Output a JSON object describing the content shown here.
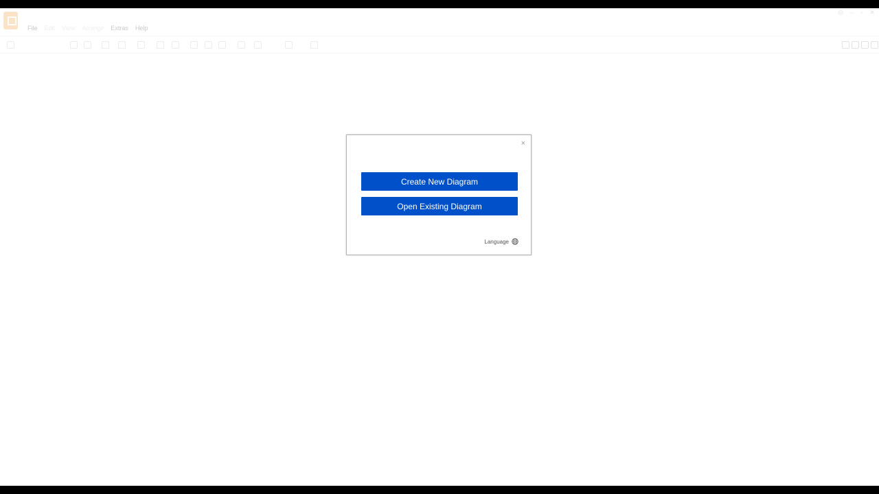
{
  "menu": {
    "items": [
      "File",
      "Edit",
      "View",
      "Arrange",
      "Extras",
      "Help"
    ]
  },
  "dialog": {
    "close_label": "×",
    "create_label": "Create New Diagram",
    "open_label": "Open Existing Diagram",
    "language_label": "Language"
  },
  "colors": {
    "primary_button": "#0051c9",
    "logo": "#fbe3c8"
  },
  "icons": [
    "globe-icon",
    "close-icon",
    "app-logo-icon"
  ]
}
